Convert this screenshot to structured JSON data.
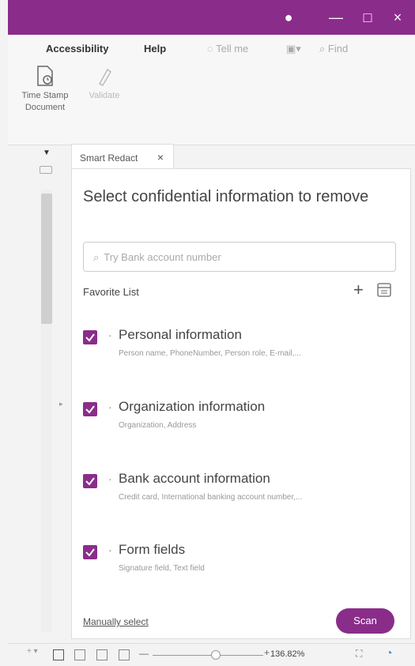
{
  "titlebar": {
    "buttons": [
      {
        "name": "account-icon",
        "glyph": "●"
      },
      {
        "name": "minimize-icon",
        "glyph": "—"
      },
      {
        "name": "maximize-icon",
        "glyph": "□"
      },
      {
        "name": "close-icon",
        "glyph": "×"
      }
    ]
  },
  "menu": {
    "items": [
      "Accessibility",
      "Help"
    ],
    "tell_me": "Tell me",
    "find": "Find"
  },
  "ribbon": {
    "timestamp_label": "Time Stamp\nDocument",
    "validate_label": "Validate"
  },
  "tab": {
    "label": "Smart Redact",
    "close": "×"
  },
  "panel": {
    "title": "Select confidential information to remove",
    "search_placeholder": "Try Bank account number",
    "favorite_label": "Favorite List",
    "add": "+",
    "items": [
      {
        "title": "Personal information",
        "desc": "Person name, PhoneNumber, Person role, E-mail,...",
        "checked": true
      },
      {
        "title": "Organization information",
        "desc": "Organization, Address",
        "checked": true
      },
      {
        "title": "Bank account information",
        "desc": "Credit card, International banking account number,...",
        "checked": true
      },
      {
        "title": "Form fields",
        "desc": "Signature field, Text field",
        "checked": true
      }
    ],
    "manual_select": "Manually select",
    "scan": "Scan"
  },
  "status": {
    "zoom": "136.82%",
    "minus": "—",
    "plus": "+"
  },
  "colors": {
    "accent": "#8a2d8a"
  }
}
